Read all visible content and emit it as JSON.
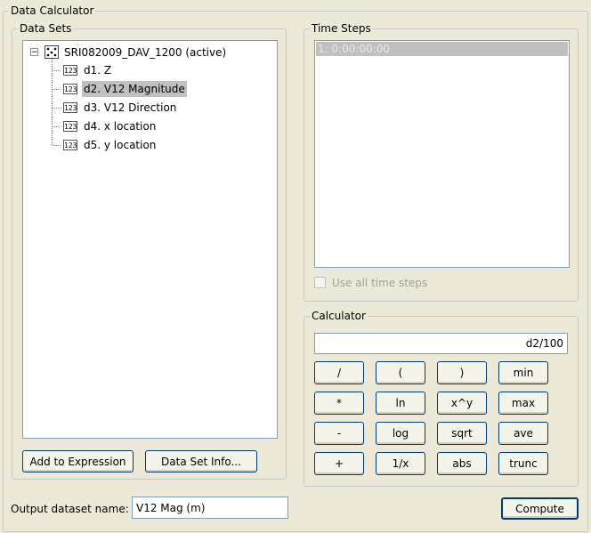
{
  "window": {
    "title": "Data Calculator"
  },
  "datasets": {
    "legend": "Data Sets",
    "root": {
      "expander": "−",
      "label": "SRI082009_DAV_1200 (active)"
    },
    "items": [
      {
        "icon": "123",
        "label": "d1. Z",
        "selected": false
      },
      {
        "icon": "123",
        "label": "d2. V12 Magnitude",
        "selected": true
      },
      {
        "icon": "123",
        "label": "d3. V12 Direction",
        "selected": false
      },
      {
        "icon": "123",
        "label": "d4. x location",
        "selected": false
      },
      {
        "icon": "123",
        "label": "d5. y location",
        "selected": false
      }
    ],
    "add_button": "Add to Expression",
    "info_button": "Data Set Info..."
  },
  "timesteps": {
    "legend": "Time Steps",
    "items": [
      {
        "label": "1: 0:00:00:00"
      }
    ],
    "use_all_label": "Use all time steps"
  },
  "calculator": {
    "legend": "Calculator",
    "expression": "d2/100",
    "buttons": [
      [
        "/",
        "(",
        ")",
        "min"
      ],
      [
        "*",
        "ln",
        "x^y",
        "max"
      ],
      [
        "-",
        "log",
        "sqrt",
        "ave"
      ],
      [
        "+",
        "1/x",
        "abs",
        "trunc"
      ]
    ]
  },
  "output": {
    "label": "Output dataset name:",
    "value": "V12 Mag (m)"
  },
  "compute_button": "Compute",
  "colors": {
    "background": "#ece9d8",
    "selection": "#c0c0c0",
    "border": "#7f9db9"
  }
}
